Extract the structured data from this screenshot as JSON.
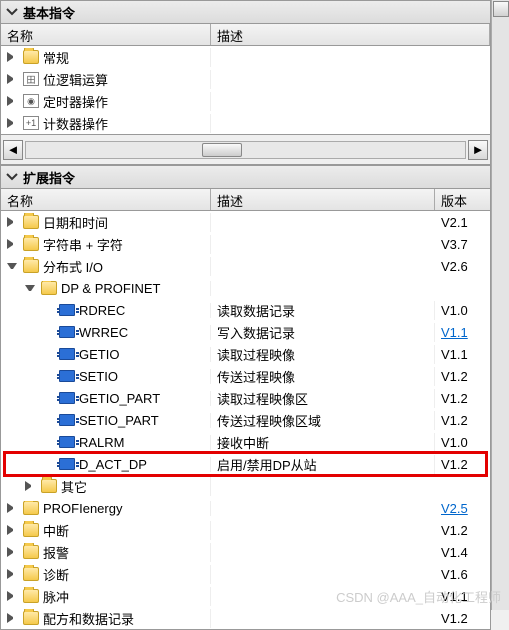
{
  "basic": {
    "title": "基本指令",
    "cols": {
      "name": "名称",
      "desc": "描述"
    },
    "items": [
      {
        "label": "常规",
        "icon": "folder",
        "tri": "closed",
        "indent": 1
      },
      {
        "label": "位逻辑运算",
        "icon": "ov",
        "ov": "田",
        "tri": "closed",
        "indent": 1
      },
      {
        "label": "定时器操作",
        "icon": "ov",
        "ov": "◉",
        "tri": "closed",
        "indent": 1
      },
      {
        "label": "计数器操作",
        "icon": "ov",
        "ov": "+1",
        "tri": "closed",
        "indent": 1
      }
    ]
  },
  "ext": {
    "title": "扩展指令",
    "cols": {
      "name": "名称",
      "desc": "描述",
      "ver": "版本"
    },
    "items": [
      {
        "label": "日期和时间",
        "icon": "folder",
        "tri": "closed",
        "indent": 1,
        "ver": "V2.1"
      },
      {
        "label": "字符串 + 字符",
        "icon": "folder",
        "tri": "closed",
        "indent": 1,
        "ver": "V3.7"
      },
      {
        "label": "分布式 I/O",
        "icon": "folder",
        "tri": "open",
        "indent": 1,
        "ver": "V2.6"
      },
      {
        "label": "DP & PROFINET",
        "icon": "folder",
        "tri": "open",
        "indent": 2
      },
      {
        "label": "RDREC",
        "icon": "block",
        "tri": "none",
        "indent": 3,
        "desc": "读取数据记录",
        "ver": "V1.0"
      },
      {
        "label": "WRREC",
        "icon": "block",
        "tri": "none",
        "indent": 3,
        "desc": "写入数据记录",
        "ver": "V1.1",
        "link": true
      },
      {
        "label": "GETIO",
        "icon": "block",
        "tri": "none",
        "indent": 3,
        "desc": "读取过程映像",
        "ver": "V1.1"
      },
      {
        "label": "SETIO",
        "icon": "block",
        "tri": "none",
        "indent": 3,
        "desc": "传送过程映像",
        "ver": "V1.2"
      },
      {
        "label": "GETIO_PART",
        "icon": "block",
        "tri": "none",
        "indent": 3,
        "desc": "读取过程映像区",
        "ver": "V1.2"
      },
      {
        "label": "SETIO_PART",
        "icon": "block",
        "tri": "none",
        "indent": 3,
        "desc": "传送过程映像区域",
        "ver": "V1.2"
      },
      {
        "label": "RALRM",
        "icon": "block",
        "tri": "none",
        "indent": 3,
        "desc": "接收中断",
        "ver": "V1.0"
      },
      {
        "label": "D_ACT_DP",
        "icon": "block",
        "tri": "none",
        "indent": 3,
        "desc": "启用/禁用DP从站",
        "ver": "V1.2",
        "hl": true
      },
      {
        "label": "其它",
        "icon": "folder",
        "tri": "closed",
        "indent": 2
      },
      {
        "label": "PROFIenergy",
        "icon": "folder",
        "tri": "closed",
        "indent": 1,
        "ver": "V2.5",
        "link": true
      },
      {
        "label": "中断",
        "icon": "folder",
        "tri": "closed",
        "indent": 1,
        "ver": "V1.2"
      },
      {
        "label": "报警",
        "icon": "folder",
        "tri": "closed",
        "indent": 1,
        "ver": "V1.4"
      },
      {
        "label": "诊断",
        "icon": "folder",
        "tri": "closed",
        "indent": 1,
        "ver": "V1.6"
      },
      {
        "label": "脉冲",
        "icon": "folder",
        "tri": "closed",
        "indent": 1,
        "ver": "V1.1"
      },
      {
        "label": "配方和数据记录",
        "icon": "folder",
        "tri": "closed",
        "indent": 1,
        "ver": "V1.2"
      }
    ]
  },
  "watermark": "CSDN @AAA_自动化工程师"
}
